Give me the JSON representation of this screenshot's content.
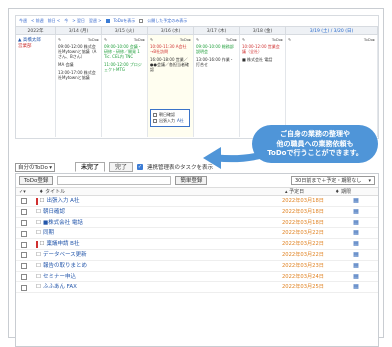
{
  "calendar": {
    "toolbar": [
      "今週",
      "< 前週",
      "前日 <",
      "今",
      "> 翌日",
      "翌週 >"
    ],
    "toolbar_options": [
      "ToDoを表示",
      "公開した予定のみ表示"
    ],
    "headers": [
      "2022年",
      "3/14 (月)",
      "3/15 (火)",
      "3/16 (水)",
      "3/17 (木)",
      "3/18 (金)",
      "3/19 (土) / 3/20 (日)"
    ],
    "user_name": "▲ 高橋太郎",
    "user_sub": "営業部",
    "cells": [
      {
        "head_left": "✎",
        "head_right": "ToDo▸",
        "events": [
          {
            "text": "09:00-12:00 株式会社Mytownと協議（Aさん、Bさん）",
            "color": ""
          },
          {
            "text": "MA 会議",
            "color": ""
          },
          {
            "text": "13:00-17:00 株式会社Mytownと協議",
            "color": ""
          }
        ]
      },
      {
        "head_left": "✎",
        "head_right": "ToDo▸",
        "events": [
          {
            "text": "09:00-10:00 会議・研修・研修／開発 1 Tic. CEL内 TNC",
            "color": "green"
          },
          {
            "text": "11:00-12:00 プロジェクトMTG",
            "color": "green"
          }
        ]
      },
      {
        "head_left": "✎",
        "head_right": "ToDo▸",
        "events": [
          {
            "text": "10:00-11:30 A会社→B社訪問",
            "color": "red"
          },
          {
            "text": "16:00-18:00 営業／●●会議／各担当者確認",
            "color": ""
          }
        ]
      },
      {
        "head_left": "✎",
        "head_right": "ToDo▸",
        "events": [
          {
            "text": "09:00-10:00 総務部説明会",
            "color": "green"
          },
          {
            "text": "13:00-16:00 作業・打合せ",
            "color": ""
          }
        ]
      },
      {
        "head_left": "✎",
        "head_right": "ToDo▸",
        "events": [
          {
            "text": "10:00-12:00 営業会議（全社）",
            "color": "red"
          },
          {
            "text": "■ 株式会社 電話",
            "color": ""
          }
        ]
      },
      {
        "head_left": "✎",
        "head_right": "ToDo▸",
        "events": []
      }
    ],
    "todo_popup": [
      {
        "label": "朝日確認",
        "link": ""
      },
      {
        "label": "出張入力",
        "link": "A社"
      }
    ]
  },
  "bubble": {
    "line1": "ご自身の業務の整理や",
    "line2": "他の職員への業務依頼も",
    "line3": "ToDoで行うことができます。"
  },
  "todo_controls": {
    "filter_select": "自分のToDo",
    "tab_incomplete": "未完了",
    "tab_complete": "完了",
    "show_followed": "連携管理表のタスクを表示",
    "register_button": "ToDo登録",
    "quick_register_button": "簡単登録",
    "range_select": "30日前まで＋予定・期限なし"
  },
  "table": {
    "col_title": "タイトル",
    "col_due": "予定日",
    "col_period": "期限",
    "rows": [
      {
        "title": "出張入力",
        "suffix": "A社",
        "due": "2022年03月18日",
        "flag": true
      },
      {
        "title": "朝日確認",
        "suffix": "",
        "due": "2022年03月18日",
        "flag": false
      },
      {
        "title": "■株式会社",
        "suffix": "電話",
        "due": "2022年03月18日",
        "flag": false
      },
      {
        "title": "同期",
        "suffix": "",
        "due": "2022年03月22日",
        "flag": false
      },
      {
        "title": "稟議申請",
        "suffix": "B社",
        "due": "2022年03月22日",
        "flag": true
      },
      {
        "title": "データベース更新",
        "suffix": "",
        "due": "2022年03月22日",
        "flag": false
      },
      {
        "title": "報告の取りまとめ",
        "suffix": "",
        "due": "2022年03月23日",
        "flag": false
      },
      {
        "title": "セミナー申込",
        "suffix": "",
        "due": "2022年03月24日",
        "flag": false
      },
      {
        "title": "ふふあん",
        "suffix": "FAX",
        "due": "2022年03月25日",
        "flag": false
      }
    ]
  },
  "colors": {
    "accent": "#3a7bd5",
    "bubble": "#4f95d8",
    "due_text": "#e0801e",
    "flag": "#d03030"
  }
}
